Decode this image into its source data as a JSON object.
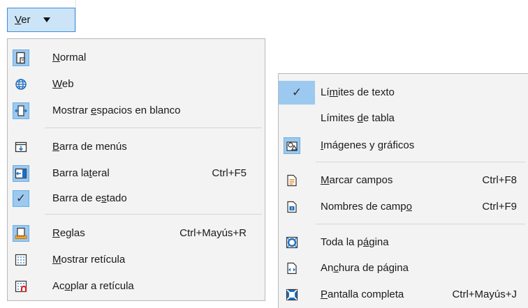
{
  "ver_menu": {
    "label": "Ver",
    "underline_letter": "V",
    "rest": "er"
  },
  "menu_left": [
    {
      "id": "normal",
      "pre": "",
      "u": "N",
      "post": "ormal",
      "shortcut": "",
      "icon": "normal-view-icon",
      "selected": true
    },
    {
      "id": "web",
      "pre": "",
      "u": "W",
      "post": "eb",
      "shortcut": "",
      "icon": "globe-icon",
      "selected": false
    },
    {
      "id": "whitespace",
      "pre": "Mostrar ",
      "u": "e",
      "post": "spacios en blanco",
      "shortcut": "",
      "icon": "whitespace-icon",
      "selected": true
    },
    {
      "id": "menubar",
      "pre": "",
      "u": "B",
      "post": "arra de menús",
      "shortcut": "",
      "icon": "menubar-icon",
      "selected": false
    },
    {
      "id": "sidebar",
      "pre": "Barra la",
      "u": "t",
      "post": "eral",
      "shortcut": "Ctrl+F5",
      "icon": "sidebar-icon",
      "selected": true
    },
    {
      "id": "statusbar",
      "pre": "Barra de e",
      "u": "s",
      "post": "tado",
      "shortcut": "",
      "icon": "check-icon",
      "selected": true
    },
    {
      "id": "rulers",
      "pre": "",
      "u": "R",
      "post": "eglas",
      "shortcut": "Ctrl+Mayús+R",
      "icon": "rulers-icon",
      "selected": true
    },
    {
      "id": "grid",
      "pre": "",
      "u": "M",
      "post": "ostrar retícula",
      "shortcut": "",
      "icon": "grid-icon",
      "selected": false
    },
    {
      "id": "snap",
      "pre": "Ac",
      "u": "o",
      "post": "plar a retícula",
      "shortcut": "",
      "icon": "snap-grid-icon",
      "selected": false
    }
  ],
  "menu_right": [
    {
      "id": "text-bounds",
      "pre": "Lí",
      "u": "m",
      "post": "ites de texto",
      "shortcut": "",
      "icon": "check-icon",
      "selected": true
    },
    {
      "id": "table-bounds",
      "pre": "Límites ",
      "u": "d",
      "post": "e tabla",
      "shortcut": "",
      "icon": "",
      "selected": false
    },
    {
      "id": "images",
      "pre": "",
      "u": "I",
      "post": "mágenes y gráficos",
      "shortcut": "",
      "icon": "images-charts-icon",
      "selected": true
    },
    {
      "id": "field-shadings",
      "pre": "",
      "u": "M",
      "post": "arcar campos",
      "shortcut": "Ctrl+F8",
      "icon": "field-shadings-icon",
      "selected": false
    },
    {
      "id": "field-names",
      "pre": "Nombres de camp",
      "u": "o",
      "post": "",
      "shortcut": "Ctrl+F9",
      "icon": "field-names-icon",
      "selected": false
    },
    {
      "id": "whole-page",
      "pre": "Toda la p",
      "u": "á",
      "post": "gina",
      "shortcut": "",
      "icon": "whole-page-icon",
      "selected": false
    },
    {
      "id": "page-width",
      "pre": "An",
      "u": "c",
      "post": "hura de página",
      "shortcut": "",
      "icon": "page-width-icon",
      "selected": false
    },
    {
      "id": "fullscreen",
      "pre": "",
      "u": "P",
      "post": "antalla completa",
      "shortcut": "Ctrl+Mayús+J",
      "icon": "fullscreen-icon",
      "selected": false
    }
  ]
}
